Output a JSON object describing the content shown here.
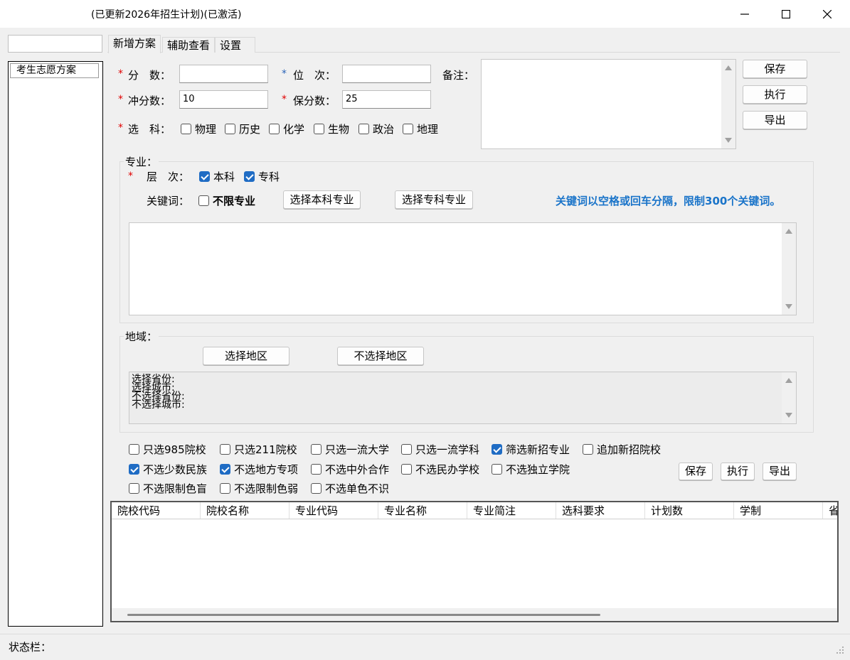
{
  "window": {
    "title": "(已更新2026年招生计划)(已激活)"
  },
  "sidebar": {
    "search_value": "",
    "items": [
      {
        "label": "考生志愿方案"
      }
    ]
  },
  "tabs": [
    {
      "label": "新增方案"
    },
    {
      "label": "辅助查看"
    },
    {
      "label": "设置"
    }
  ],
  "form": {
    "score": {
      "label": "分　数：",
      "value": ""
    },
    "rank": {
      "label": "位　次：",
      "value": ""
    },
    "remark": {
      "label": "备注：",
      "value": ""
    },
    "rush_score": {
      "label": "冲分数：",
      "value": "10"
    },
    "safe_score": {
      "label": "保分数：",
      "value": "25"
    },
    "subjects": {
      "label": "选　科：",
      "options": [
        {
          "label": "物理",
          "checked": false
        },
        {
          "label": "历史",
          "checked": false
        },
        {
          "label": "化学",
          "checked": false
        },
        {
          "label": "生物",
          "checked": false
        },
        {
          "label": "政治",
          "checked": false
        },
        {
          "label": "地理",
          "checked": false
        }
      ]
    }
  },
  "top_buttons": {
    "save": "保存",
    "execute": "执行",
    "export": "导出"
  },
  "major": {
    "group_title": "专业：",
    "level_label": "层　次：",
    "levels": [
      {
        "label": "本科",
        "checked": true
      },
      {
        "label": "专科",
        "checked": true
      }
    ],
    "keyword_label": "关键词：",
    "unlimited_label": "不限专业",
    "select_bachelor": "选择本科专业",
    "select_college": "选择专科专业",
    "hint": "关键词以空格或回车分隔，限制300个关键词。",
    "keywords_value": ""
  },
  "region": {
    "group_title": "地域：",
    "select_btn": "选择地区",
    "exclude_btn": "不选择地区",
    "lines": [
      "选择省份:",
      "选择城市:",
      "不选择省份:",
      "不选择城市:"
    ]
  },
  "filters": [
    [
      {
        "label": "只选985院校",
        "checked": false
      },
      {
        "label": "只选211院校",
        "checked": false
      },
      {
        "label": "只选一流大学",
        "checked": false
      },
      {
        "label": "只选一流学科",
        "checked": false
      },
      {
        "label": "筛选新招专业",
        "checked": true
      },
      {
        "label": "追加新招院校",
        "checked": false
      }
    ],
    [
      {
        "label": "不选少数民族",
        "checked": true
      },
      {
        "label": "不选地方专项",
        "checked": true
      },
      {
        "label": "不选中外合作",
        "checked": false
      },
      {
        "label": "不选民办学校",
        "checked": false
      },
      {
        "label": "不选独立学院",
        "checked": false
      }
    ],
    [
      {
        "label": "不选限制色盲",
        "checked": false
      },
      {
        "label": "不选限制色弱",
        "checked": false
      },
      {
        "label": "不选单色不识",
        "checked": false
      }
    ]
  ],
  "bottom_buttons": {
    "save": "保存",
    "execute": "执行",
    "export": "导出"
  },
  "table": {
    "columns": [
      "院校代码",
      "院校名称",
      "专业代码",
      "专业名称",
      "专业简注",
      "选科要求",
      "计划数",
      "学制",
      "省"
    ],
    "rows": []
  },
  "status": {
    "label": "状态栏："
  },
  "colors": {
    "accent": "#1f6cc4",
    "required": "#e00000",
    "hint": "#1a74c9"
  }
}
